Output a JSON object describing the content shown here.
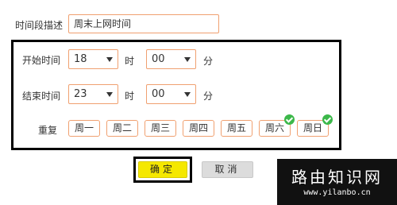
{
  "form": {
    "desc_label": "时间段描述",
    "desc_value": "周末上网时间",
    "start_label": "开始时间",
    "end_label": "结束时间",
    "start_hour": "18",
    "start_minute": "00",
    "end_hour": "23",
    "end_minute": "00",
    "hour_unit": "时",
    "minute_unit": "分",
    "repeat_label": "重复",
    "days": [
      {
        "label": "周一",
        "checked": false
      },
      {
        "label": "周二",
        "checked": false
      },
      {
        "label": "周三",
        "checked": false
      },
      {
        "label": "周四",
        "checked": false
      },
      {
        "label": "周五",
        "checked": false
      },
      {
        "label": "周六",
        "checked": true
      },
      {
        "label": "周日",
        "checked": true
      }
    ]
  },
  "buttons": {
    "ok_label": "确定",
    "cancel_label": "取消"
  },
  "watermark": {
    "title": "路由知识网",
    "url": "www.yilanbo.cn"
  },
  "colors": {
    "field_border": "#f0a070",
    "ok_button": "#f5e800",
    "check": "#3cb84a"
  }
}
